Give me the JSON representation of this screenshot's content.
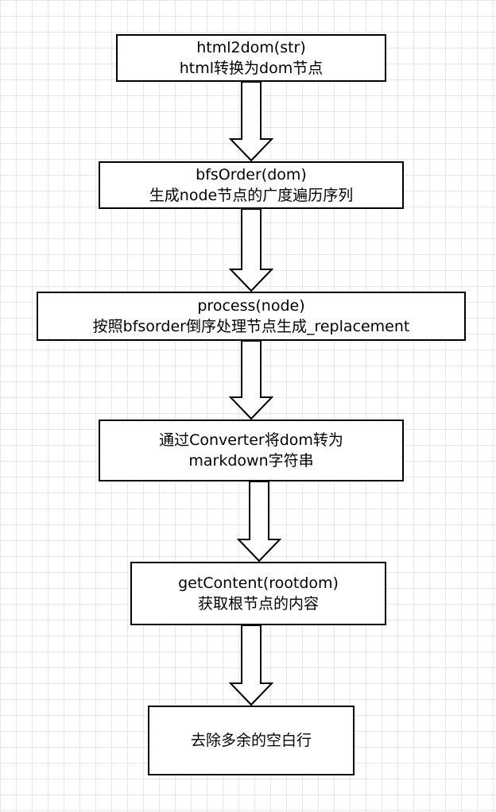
{
  "diagram": {
    "steps": [
      {
        "line1": "html2dom(str)",
        "line2": "html转换为dom节点"
      },
      {
        "line1": "bfsOrder(dom)",
        "line2": "生成node节点的广度遍历序列"
      },
      {
        "line1": "process(node)",
        "line2": "按照bfsorder倒序处理节点生成_replacement"
      },
      {
        "line1": "通过Converter将dom转为",
        "line2": "markdown字符串"
      },
      {
        "line1": "getContent(rootdom)",
        "line2": "获取根节点的内容"
      },
      {
        "line1": "去除多余的空白行",
        "line2": ""
      }
    ]
  }
}
